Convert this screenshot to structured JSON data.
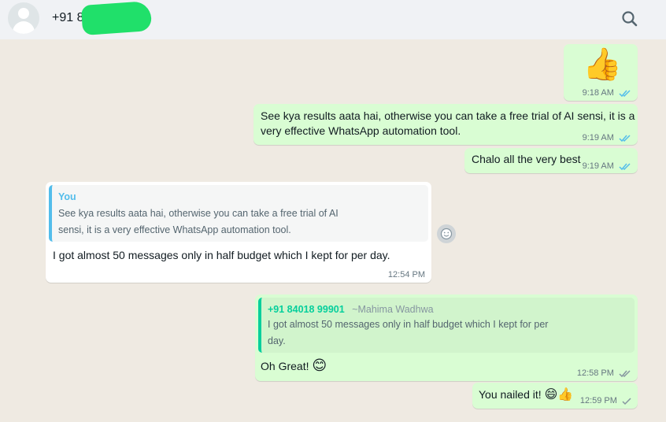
{
  "header": {
    "contact_name": "+91 8",
    "search_icon": "search-icon"
  },
  "messages": [
    {
      "id": "m1",
      "direction": "out",
      "emoji": "👍",
      "time": "9:18 AM",
      "status": "read"
    },
    {
      "id": "m2",
      "direction": "out",
      "text_line1": "See kya results aata hai, otherwise you can take a free trial of AI sensi, it is a",
      "text_line2": "very effective WhatsApp automation tool.",
      "time": "9:19 AM",
      "status": "read"
    },
    {
      "id": "m3",
      "direction": "out",
      "text": "Chalo all the very best",
      "time": "9:19 AM",
      "status": "read"
    },
    {
      "id": "m4",
      "direction": "in",
      "quote": {
        "author": "You",
        "line1": "See kya results aata hai, otherwise you can take a free trial of AI",
        "line2": "sensi, it is a very effective WhatsApp automation tool."
      },
      "text": "I got almost 50 messages only in half budget which I kept for per day.",
      "time": "12:54 PM"
    },
    {
      "id": "m5",
      "direction": "out",
      "quote": {
        "author": "+91 84018 99901",
        "author_name": "~Mahima Wadhwa",
        "line1": "I got almost 50 messages only in half budget which I kept for per",
        "line2": "day."
      },
      "text": "Oh Great! ",
      "emoji": "😊",
      "time": "12:58 PM",
      "status": "delivered"
    },
    {
      "id": "m6",
      "direction": "out",
      "text": "You nailed it! ",
      "emoji": "😄👍",
      "time": "12:59 PM",
      "status": "sent"
    }
  ],
  "colors": {
    "chat_bg": "#efeae2",
    "outgoing_bubble": "#d9fdd3",
    "incoming_bubble": "#ffffff",
    "read_tick": "#53bdeb",
    "quote_you_accent": "#53bdeb",
    "quote_other_accent": "#06cf9c"
  }
}
